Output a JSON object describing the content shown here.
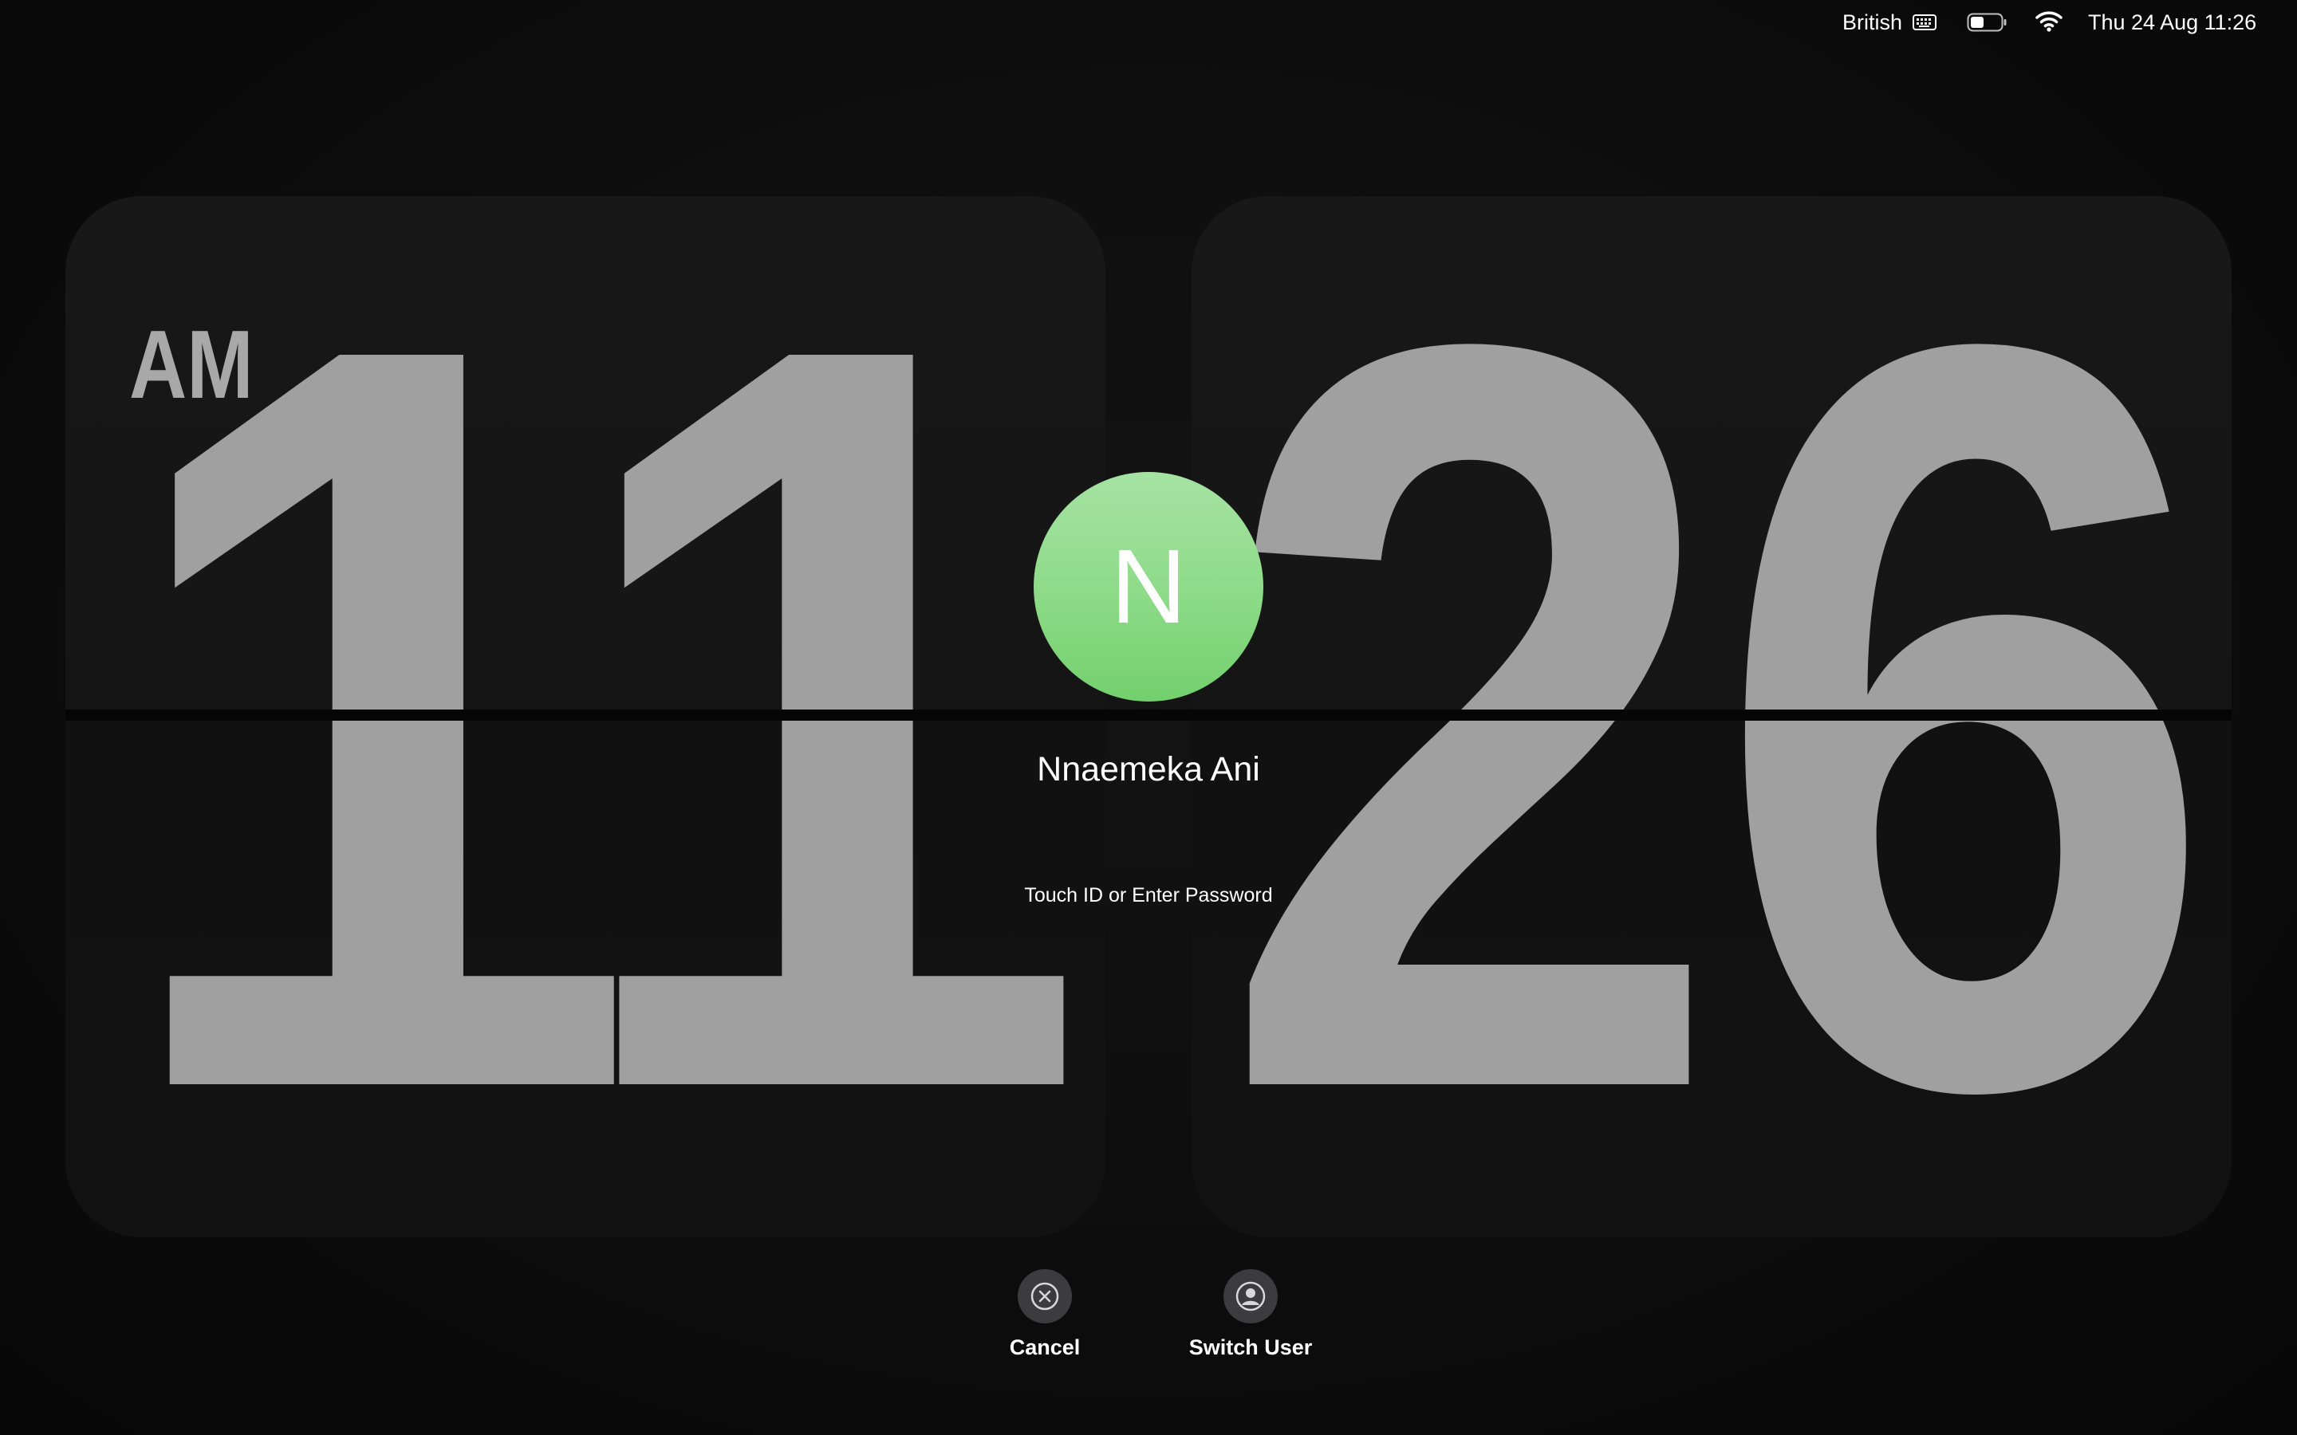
{
  "menubar": {
    "keyboard_layout": "British",
    "keyboard_icon": "keyboard-icon",
    "battery_icon": "battery-icon",
    "battery_level": 0.45,
    "wifi_icon": "wifi-icon",
    "datetime": "Thu 24 Aug 11:26"
  },
  "clock": {
    "hours": "11",
    "minutes": "26",
    "meridiem": "AM"
  },
  "user": {
    "avatar_initial": "N",
    "avatar_color": "#8fdb8a",
    "name": "Nnaemeka Ani",
    "auth_hint": "Touch ID or Enter Password"
  },
  "actions": {
    "cancel": {
      "label": "Cancel",
      "icon": "close-circle-icon"
    },
    "switch_user": {
      "label": "Switch User",
      "icon": "user-circle-icon"
    }
  }
}
